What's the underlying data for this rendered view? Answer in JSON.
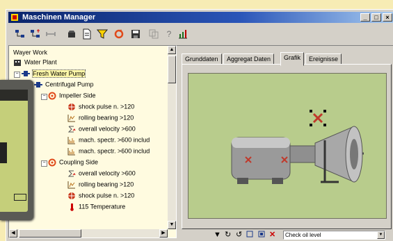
{
  "window": {
    "title": "Maschinen Manager",
    "minimize_glyph": "_",
    "maximize_glyph": "□",
    "close_glyph": "×"
  },
  "toolbar": {
    "icons": [
      "hierarchy-icon",
      "hierarchy-add-icon",
      "link-icon",
      "machine-icon",
      "document-icon",
      "filter-icon",
      "refresh-icon",
      "save-icon",
      "copy-icon",
      "help-icon",
      "report-icon"
    ],
    "glyphs": {
      "help": "?"
    }
  },
  "tree": {
    "root_label": "Wayer Work",
    "items": [
      {
        "label": "Water Plant",
        "icon": "building-icon"
      },
      {
        "label": "Fresh Water Pump",
        "icon": "pump-icon"
      },
      {
        "label": "Centrifugal Pump",
        "icon": "pump-icon"
      },
      {
        "label": "Impeller Side",
        "icon": "measuring-point-icon"
      },
      {
        "label": "shock pulse n. >120",
        "icon": "shock-pulse-icon"
      },
      {
        "label": "rolling bearing >120",
        "icon": "bearing-icon"
      },
      {
        "label": "overall velocity >600",
        "icon": "velocity-icon"
      },
      {
        "label": "mach. spectr. >600 includ",
        "icon": "spectrum-icon"
      },
      {
        "label": "mach. spectr. >600 includ",
        "icon": "spectrum-icon"
      },
      {
        "label": "Coupling Side",
        "icon": "measuring-point-icon"
      },
      {
        "label": "overall velocity >600",
        "icon": "velocity-icon"
      },
      {
        "label": "rolling bearing >120",
        "icon": "bearing-icon"
      },
      {
        "label": "shock pulse n. >120",
        "icon": "shock-pulse-icon"
      },
      {
        "label": "115 Temperature",
        "icon": "temperature-icon"
      }
    ]
  },
  "tabs": [
    {
      "label": "Grunddaten"
    },
    {
      "label": "Aggregat Daten"
    },
    {
      "label": "Grafik",
      "active": true
    },
    {
      "label": "Ereignisse"
    }
  ],
  "bottom": {
    "combo_value": "Check oil level"
  },
  "colors": {
    "title_start": "#0a246a",
    "tree_bg": "#fffbe0",
    "canvas_bg": "#b8cc8c",
    "background": "#f7ecb4"
  }
}
